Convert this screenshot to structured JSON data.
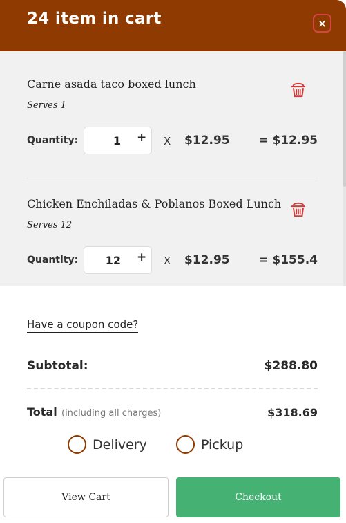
{
  "header": {
    "title": "24 item in cart",
    "close_icon": "×"
  },
  "items": [
    {
      "name": "Carne asada taco boxed lunch",
      "serves": "Serves 1",
      "quantity_label": "Quantity:",
      "quantity": "1",
      "plus": "+",
      "times": "X",
      "unit_price": "$12.95",
      "line_total": "= $12.95"
    },
    {
      "name": "Chicken Enchiladas & Poblanos Boxed Lunch",
      "serves": "Serves 12",
      "quantity_label": "Quantity:",
      "quantity": "12",
      "plus": "+",
      "times": "X",
      "unit_price": "$12.95",
      "line_total": "= $155.4"
    }
  ],
  "coupon": {
    "link_text": "Have a coupon code?"
  },
  "summary": {
    "subtotal_label": "Subtotal:",
    "subtotal_value": "$288.80",
    "total_label": "Total",
    "total_note": "(including all charges)",
    "total_value": "$318.69"
  },
  "fulfillment": {
    "options": [
      {
        "label": "Delivery"
      },
      {
        "label": "Pickup"
      }
    ]
  },
  "actions": {
    "view_cart": "View Cart",
    "checkout": "Checkout"
  },
  "colors": {
    "header": "#8e3a00",
    "trash": "#d23a3a",
    "checkout": "#45b273",
    "items_background": "#f1f1f1"
  }
}
